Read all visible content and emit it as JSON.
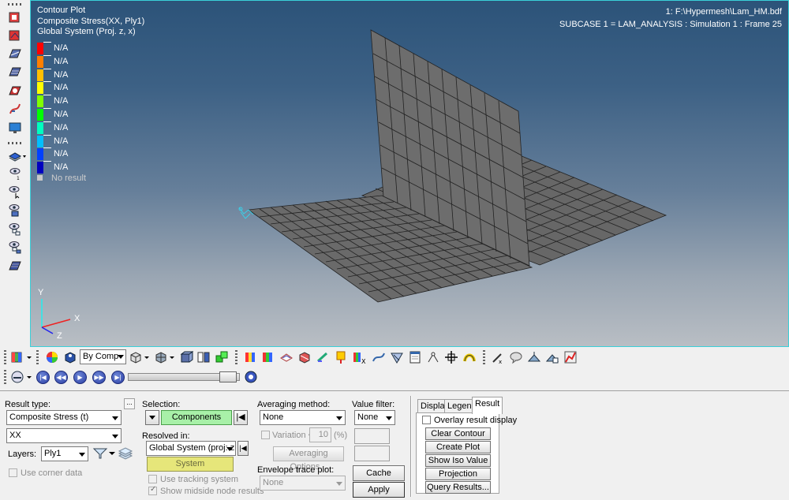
{
  "viewport": {
    "title_lines": [
      "Contour Plot",
      "Composite Stress(XX, Ply1)",
      "Global System (Proj. z, x)"
    ],
    "file_info": "1: F:\\Hypermesh\\Lam_HM.bdf",
    "subcase_info": "SUBCASE 1 = LAM_ANALYSIS  : Simulation 1 : Frame 25",
    "legend": [
      {
        "label": "N/A",
        "color": "#ff0000"
      },
      {
        "label": "N/A",
        "color": "#ff7f00"
      },
      {
        "label": "N/A",
        "color": "#ffbf00"
      },
      {
        "label": "N/A",
        "color": "#ffff00"
      },
      {
        "label": "N/A",
        "color": "#80ff00"
      },
      {
        "label": "N/A",
        "color": "#00ff00"
      },
      {
        "label": "N/A",
        "color": "#00ffbf"
      },
      {
        "label": "N/A",
        "color": "#00bfff"
      },
      {
        "label": "N/A",
        "color": "#0040ff"
      },
      {
        "label": "N/A",
        "color": "#0000c0"
      }
    ],
    "no_result_label": "No result",
    "axis_labels": {
      "y": "Y",
      "x": "X",
      "z": "Z"
    }
  },
  "toolbar": {
    "display_mode": "By Comp"
  },
  "result_panel": {
    "result_type_label": "Result type:",
    "more_button": "...",
    "result_type_value": "Composite Stress (t)",
    "component_value": "XX",
    "layers_label": "Layers:",
    "layers_value": "Ply1",
    "use_corner_data": "Use corner data"
  },
  "selection_panel": {
    "selection_label": "Selection:",
    "components_button": "Components",
    "resolved_in_label": "Resolved in:",
    "resolved_value": "Global System (proj: z, x)",
    "system_button": "System",
    "use_tracking_system": "Use tracking system",
    "show_midside": "Show midside node results"
  },
  "averaging_panel": {
    "averaging_method_label": "Averaging method:",
    "averaging_value": "None",
    "variation_label": "Variation <",
    "variation_value": "10",
    "variation_unit": "(%)",
    "averaging_options_button": "Averaging Options...",
    "envelope_label": "Envelope trace plot:",
    "envelope_value": "None"
  },
  "value_filter": {
    "label": "Value filter:",
    "value": "None",
    "cache_button": "Cache",
    "apply_button": "Apply"
  },
  "tabs": {
    "items": [
      "Display",
      "Legend",
      "Result"
    ],
    "overlay_label": "Overlay result display",
    "buttons": [
      "Clear Contour",
      "Create Plot Style...",
      "Show Iso Value",
      "Projection Rule...",
      "Query Results..."
    ]
  }
}
